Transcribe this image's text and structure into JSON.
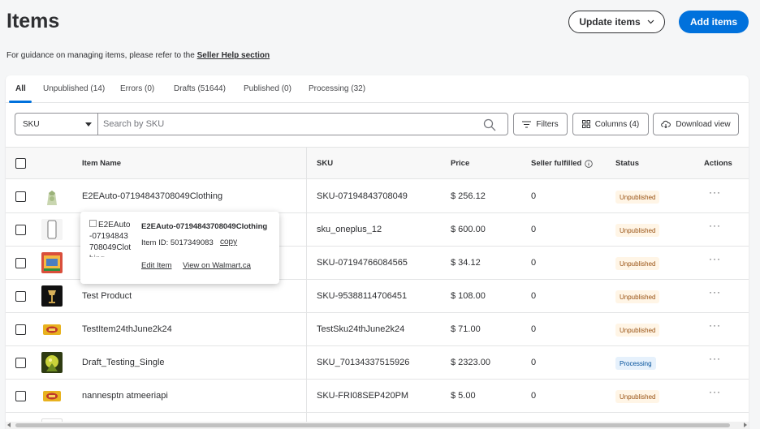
{
  "header": {
    "title": "Items",
    "guidance_text": "For guidance on managing items, please refer to the ",
    "guidance_link": "Seller Help section",
    "update_button": "Update items",
    "add_button": "Add items"
  },
  "tabs": [
    {
      "label": "All",
      "active": true
    },
    {
      "label": "Unpublished (14)"
    },
    {
      "label": "Errors (0)"
    },
    {
      "label": "Drafts (51644)"
    },
    {
      "label": "Published (0)"
    },
    {
      "label": "Processing (32)"
    }
  ],
  "toolbar": {
    "search_type": "SKU",
    "search_placeholder": "Search by SKU",
    "filters_label": "Filters",
    "columns_label": "Columns (4)",
    "download_label": "Download view"
  },
  "table": {
    "headers": {
      "item_name": "Item Name",
      "sku": "SKU",
      "price": "Price",
      "seller_fulfilled": "Seller fulfilled",
      "status": "Status",
      "actions": "Actions"
    },
    "rows": [
      {
        "name": "E2EAuto-07194843708049Clothing",
        "sku": "SKU-07194843708049",
        "price": "$ 256.12",
        "fulfilled": "0",
        "status": "Unpublished",
        "thumb": "clothing"
      },
      {
        "name": "",
        "sku": "sku_oneplus_12",
        "price": "$ 600.00",
        "fulfilled": "0",
        "status": "Unpublished",
        "thumb": "phone"
      },
      {
        "name": "",
        "sku": "SKU-07194766084565",
        "price": "$ 34.12",
        "fulfilled": "0",
        "status": "Unpublished",
        "thumb": "box"
      },
      {
        "name": "Test Product",
        "sku": "SKU-95388114706451",
        "price": "$ 108.00",
        "fulfilled": "0",
        "status": "Unpublished",
        "thumb": "lamp"
      },
      {
        "name": "TestItem24thJune2k24",
        "sku": "TestSku24thJune2k24",
        "price": "$ 71.00",
        "fulfilled": "0",
        "status": "Unpublished",
        "thumb": "snack"
      },
      {
        "name": "Draft_Testing_Single",
        "sku": "SKU_70134337515926",
        "price": "$ 2323.00",
        "fulfilled": "0",
        "status": "Processing",
        "thumb": "game"
      },
      {
        "name": "nannesptn atmeeriapi",
        "sku": "SKU-FRI08SEP420PM",
        "price": "$ 5.00",
        "fulfilled": "0",
        "status": "Unpublished",
        "thumb": "snack"
      }
    ],
    "actions_glyph": "···"
  },
  "tooltip": {
    "img_alt": "E2EAuto-07194843708049Clothing",
    "title": "E2EAuto-07194843708049Clothing",
    "item_id": "Item ID: 5017349083",
    "copy": "copy",
    "edit": "Edit Item",
    "view": "View on Walmart.ca"
  },
  "colors": {
    "primary": "#0071dc",
    "unpublished_bg": "#fff5e6",
    "unpublished_fg": "#995213",
    "processing_bg": "#e6f1fc",
    "processing_fg": "#004f9a"
  }
}
